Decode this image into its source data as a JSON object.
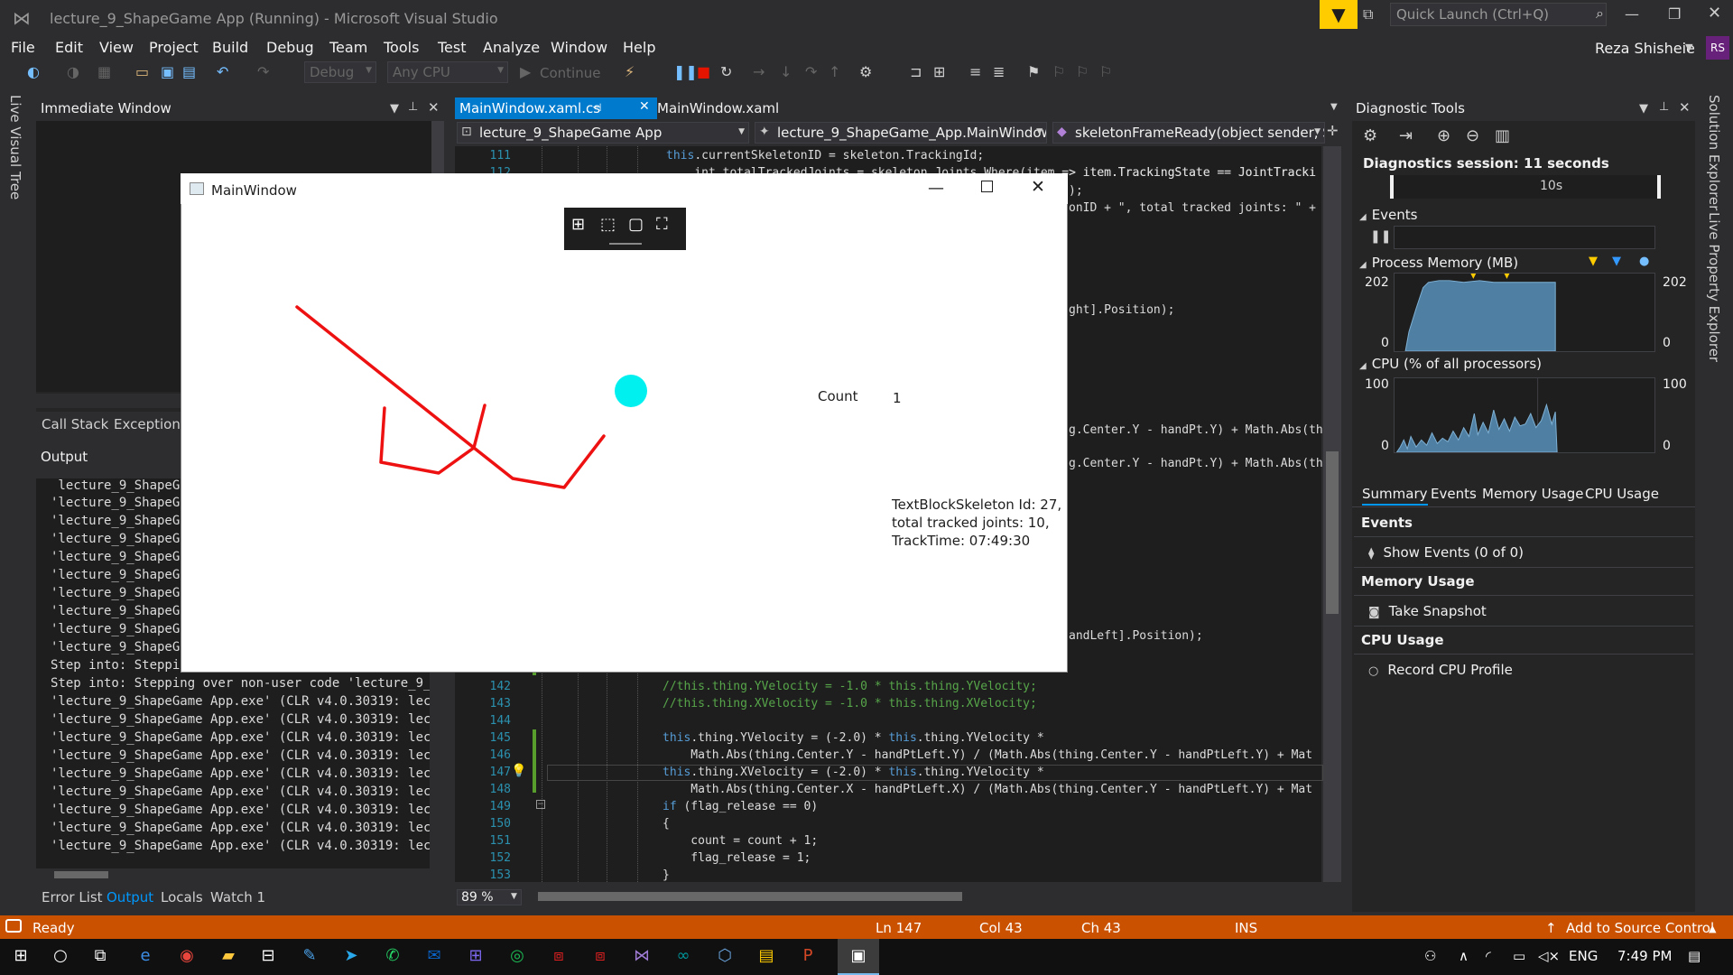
{
  "window": {
    "title": "lecture_9_ShapeGame App (Running) - Microsoft Visual Studio",
    "quick_launch_placeholder": "Quick Launch (Ctrl+Q)",
    "user_name": "Reza Shisheie",
    "user_initials": "RS",
    "accent_color": "#007acc",
    "filter_color": "#ffcc00"
  },
  "menu": [
    "File",
    "Edit",
    "View",
    "Project",
    "Build",
    "Debug",
    "Team",
    "Tools",
    "Test",
    "Analyze",
    "Window",
    "Help"
  ],
  "toolbar": {
    "config": "Debug",
    "platform": "Any CPU",
    "continue_label": "Continue"
  },
  "side_tabs": {
    "left": "Live Visual Tree",
    "right_1": "Solution Explorer",
    "right_2": "Live Property Explorer"
  },
  "immediate": {
    "title": "Immediate Window",
    "tabs": [
      "Call Stack",
      "Exception S"
    ]
  },
  "output": {
    "title": "Output",
    "lines": [
      " lecture_9_ShapeGa",
      "'lecture_9_ShapeGa",
      "'lecture_9_ShapeGa",
      "'lecture_9_ShapeGa",
      "'lecture_9_ShapeGa",
      "'lecture_9_ShapeGa",
      "'lecture_9_ShapeGa",
      "'lecture_9_ShapeGa",
      "'lecture_9_ShapeGa",
      "'lecture_9_ShapeGa",
      "Step into: Steppin",
      "Step into: Stepping over non-user code 'lecture_9_Sha",
      "'lecture_9_ShapeGame App.exe' (CLR v4.0.30319: lectu",
      "'lecture_9_ShapeGame App.exe' (CLR v4.0.30319: lectu",
      "'lecture_9_ShapeGame App.exe' (CLR v4.0.30319: lectu",
      "'lecture_9_ShapeGame App.exe' (CLR v4.0.30319: lectu",
      "'lecture_9_ShapeGame App.exe' (CLR v4.0.30319: lectu",
      "'lecture_9_ShapeGame App.exe' (CLR v4.0.30319: lectu",
      "'lecture_9_ShapeGame App.exe' (CLR v4.0.30319: lectu",
      "'lecture_9_ShapeGame App.exe' (CLR v4.0.30319: lectu",
      "'lecture_9_ShapeGame App.exe' (CLR v4.0.30319: lectu"
    ],
    "tabs": [
      "Error List",
      "Output",
      "Locals",
      "Watch 1"
    ]
  },
  "editor": {
    "active_tab": "MainWindow.xaml.cs",
    "inactive_tab": "MainWindow.xaml",
    "nav_project": "lecture_9_ShapeGame App",
    "nav_class": "lecture_9_ShapeGame_App.MainWindow",
    "nav_member": "skeletonFrameReady(object sender, Skelet",
    "zoom": "89 %",
    "lines_top": [
      {
        "num": "111",
        "code": "    this.currentSkeletonID = skeleton.TrackingId;"
      },
      {
        "num": "112",
        "code": "    int totalTrackedJoints = skeleton.Joints.Where(item => item.TrackingState == JointTracki"
      }
    ],
    "visible_fragments": [
      {
        "text": "> item.TrackingState == JointTracki"
      },
      {
        "text": ");"
      },
      {
        "text": "onID + \", total tracked joints: \" +"
      },
      {
        "text": "ght].Position);"
      },
      {
        "text": "g.Center.Y - handPt.Y) + Math.Abs(th"
      },
      {
        "text": "g.Center.Y - handPt.Y) + Math.Abs(th"
      },
      {
        "text": "andLeft].Position);"
      }
    ],
    "lines_bottom": [
      {
        "num": "142",
        "code": "//this.thing.YVelocity = -1.0 * this.thing.YVelocity;",
        "comment": true
      },
      {
        "num": "143",
        "code": "//this.thing.XVelocity = -1.0 * this.thing.XVelocity;",
        "comment": true
      },
      {
        "num": "144",
        "code": ""
      },
      {
        "num": "145",
        "code": "this.thing.YVelocity = (-2.0) * this.thing.YVelocity *"
      },
      {
        "num": "146",
        "code": "    Math.Abs(thing.Center.Y - handPtLeft.Y) / (Math.Abs(thing.Center.Y - handPtLeft.Y) + Mat"
      },
      {
        "num": "147",
        "code": "this.thing.XVelocity = (-2.0) * this.thing.YVelocity *"
      },
      {
        "num": "148",
        "code": "    Math.Abs(thing.Center.X - handPtLeft.X) / (Math.Abs(thing.Center.Y - handPtLeft.Y) + Mat"
      },
      {
        "num": "149",
        "code": "if (flag_release == 0)"
      },
      {
        "num": "150",
        "code": "{"
      },
      {
        "num": "151",
        "code": "    count = count + 1;"
      },
      {
        "num": "152",
        "code": "    flag_release = 1;"
      },
      {
        "num": "153",
        "code": "}"
      }
    ]
  },
  "diagnostics": {
    "title": "Diagnostic Tools",
    "session": "Diagnostics session: 11 seconds",
    "timeline_label": "10s",
    "events_title": "Events",
    "memory_title": "Process Memory (MB)",
    "memory_max": "202",
    "memory_min": "0",
    "cpu_title": "CPU (% of all processors)",
    "cpu_max": "100",
    "cpu_min": "0",
    "chart_color": "#4f7fa3",
    "tabs": [
      "Summary",
      "Events",
      "Memory Usage",
      "CPU Usage"
    ],
    "events_header": "Events",
    "show_events": "Show Events (0 of 0)",
    "memory_header": "Memory Usage",
    "take_snapshot": "Take Snapshot",
    "cpu_header": "CPU Usage",
    "record_cpu": "Record CPU Profile"
  },
  "app": {
    "title": "MainWindow",
    "count_label": "Count",
    "count_value": "1",
    "skeleton_text": "TextBlockSkeleton Id: 27,\ntotal tracked joints: 10,\nTrackTime: 07:49:30",
    "skeleton_color": "#ee1111",
    "ball_color": "#00f0f0"
  },
  "status": {
    "ready": "Ready",
    "ln": "Ln 147",
    "col": "Col 43",
    "ch": "Ch 43",
    "ins": "INS",
    "source_control": "Add to Source Control",
    "color": "#ca5100"
  },
  "taskbar": {
    "lang": "ENG",
    "time": "7:49 PM"
  }
}
